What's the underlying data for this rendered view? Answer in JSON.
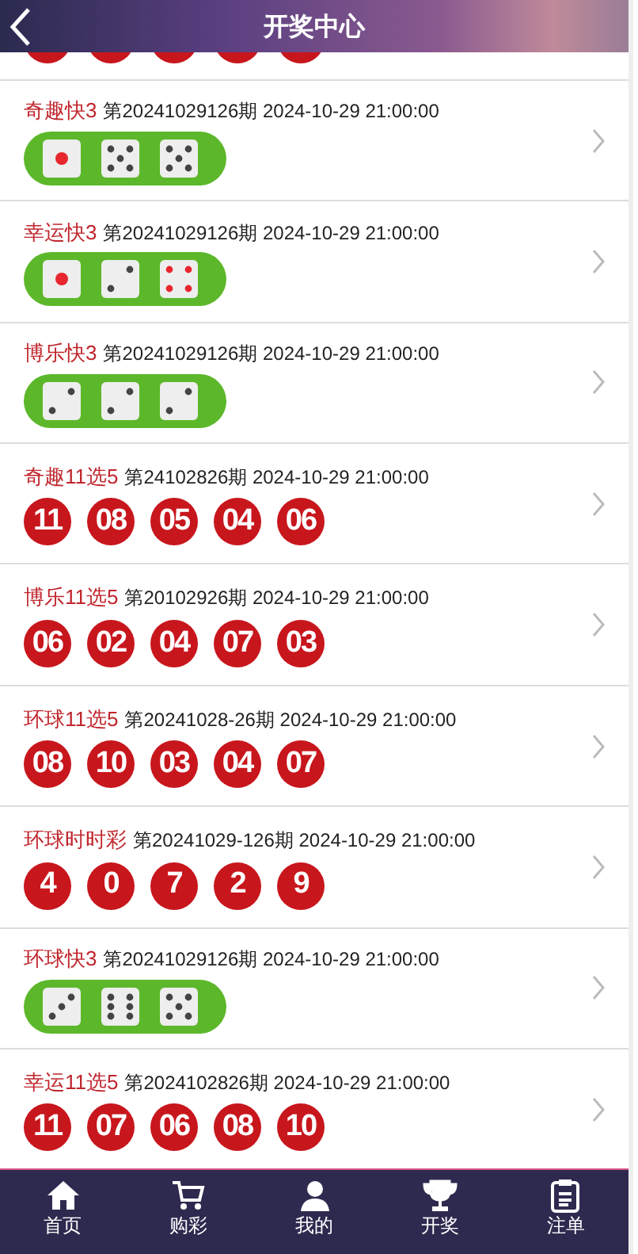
{
  "header": {
    "title": "开奖中心"
  },
  "results": [
    {
      "kind": "cut_off"
    },
    {
      "kind": "dice",
      "name": "奇趣快3",
      "issue": "第20241029126期 2024-10-29 21:00:00",
      "dice": [
        {
          "kind": "one"
        },
        {
          "kind": "five"
        },
        {
          "kind": "five"
        }
      ]
    },
    {
      "kind": "dice",
      "name": "幸运快3",
      "issue": "第20241029126期 2024-10-29 21:00:00",
      "dice": [
        {
          "kind": "one"
        },
        {
          "kind": "two"
        },
        {
          "kind": "four"
        }
      ]
    },
    {
      "kind": "dice",
      "name": "博乐快3",
      "issue": "第20241029126期 2024-10-29 21:00:00",
      "dice": [
        {
          "kind": "two"
        },
        {
          "kind": "two"
        },
        {
          "kind": "two"
        }
      ]
    },
    {
      "kind": "balls",
      "name": "奇趣11选5",
      "issue": "第24102826期 2024-10-29 21:00:00",
      "balls": [
        "11",
        "08",
        "05",
        "04",
        "06"
      ]
    },
    {
      "kind": "balls",
      "name": "博乐11选5",
      "issue": "第20102926期 2024-10-29 21:00:00",
      "balls": [
        "06",
        "02",
        "04",
        "07",
        "03"
      ]
    },
    {
      "kind": "balls",
      "name": "环球11选5",
      "issue": "第20241028-26期 2024-10-29 21:00:00",
      "balls": [
        "08",
        "10",
        "03",
        "04",
        "07"
      ]
    },
    {
      "kind": "balls",
      "name": "环球时时彩",
      "issue": "第20241029-126期 2024-10-29 21:00:00",
      "balls": [
        "4",
        "0",
        "7",
        "2",
        "9"
      ]
    },
    {
      "kind": "dice",
      "name": "环球快3",
      "issue": "第20241029126期 2024-10-29 21:00:00",
      "dice": [
        {
          "kind": "three"
        },
        {
          "kind": "six"
        },
        {
          "kind": "five"
        }
      ]
    },
    {
      "kind": "balls",
      "name": "幸运11选5",
      "issue": "第2024102826期 2024-10-29 21:00:00",
      "balls": [
        "11",
        "07",
        "06",
        "08",
        "10"
      ]
    }
  ],
  "tabbar": [
    {
      "label": "首页"
    },
    {
      "label": "购彩"
    },
    {
      "label": "我的"
    },
    {
      "label": "开奖"
    },
    {
      "label": "注单"
    }
  ]
}
